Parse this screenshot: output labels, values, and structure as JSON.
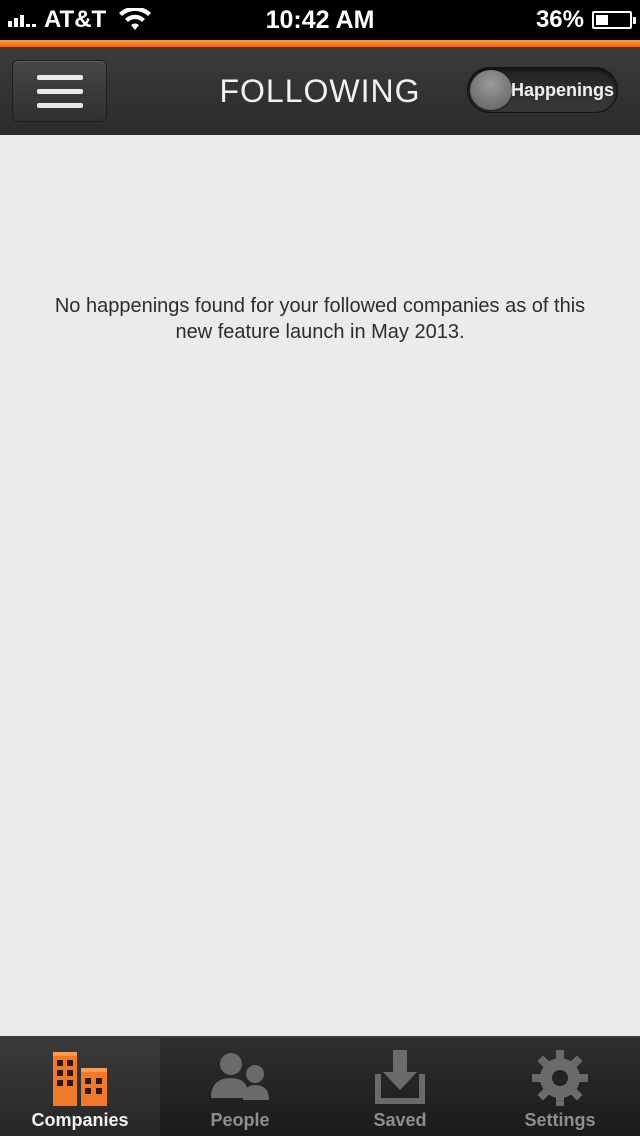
{
  "status_bar": {
    "carrier": "AT&T",
    "time": "10:42 AM",
    "battery_percent": "36%",
    "battery_level": 0.36
  },
  "nav": {
    "title": "FOLLOWING",
    "toggle_label": "Happenings"
  },
  "content": {
    "empty_message": "No happenings found for your followed companies as of this new feature launch in May 2013."
  },
  "tab_bar": {
    "tabs": [
      {
        "label": "Companies",
        "icon": "buildings-icon",
        "active": true
      },
      {
        "label": "People",
        "icon": "people-icon",
        "active": false
      },
      {
        "label": "Saved",
        "icon": "download-tray-icon",
        "active": false
      },
      {
        "label": "Settings",
        "icon": "gear-icon",
        "active": false
      }
    ]
  },
  "colors": {
    "accent": "#e8651c",
    "active_icon": "#f07a2a",
    "inactive_icon": "#6a6a6a"
  }
}
